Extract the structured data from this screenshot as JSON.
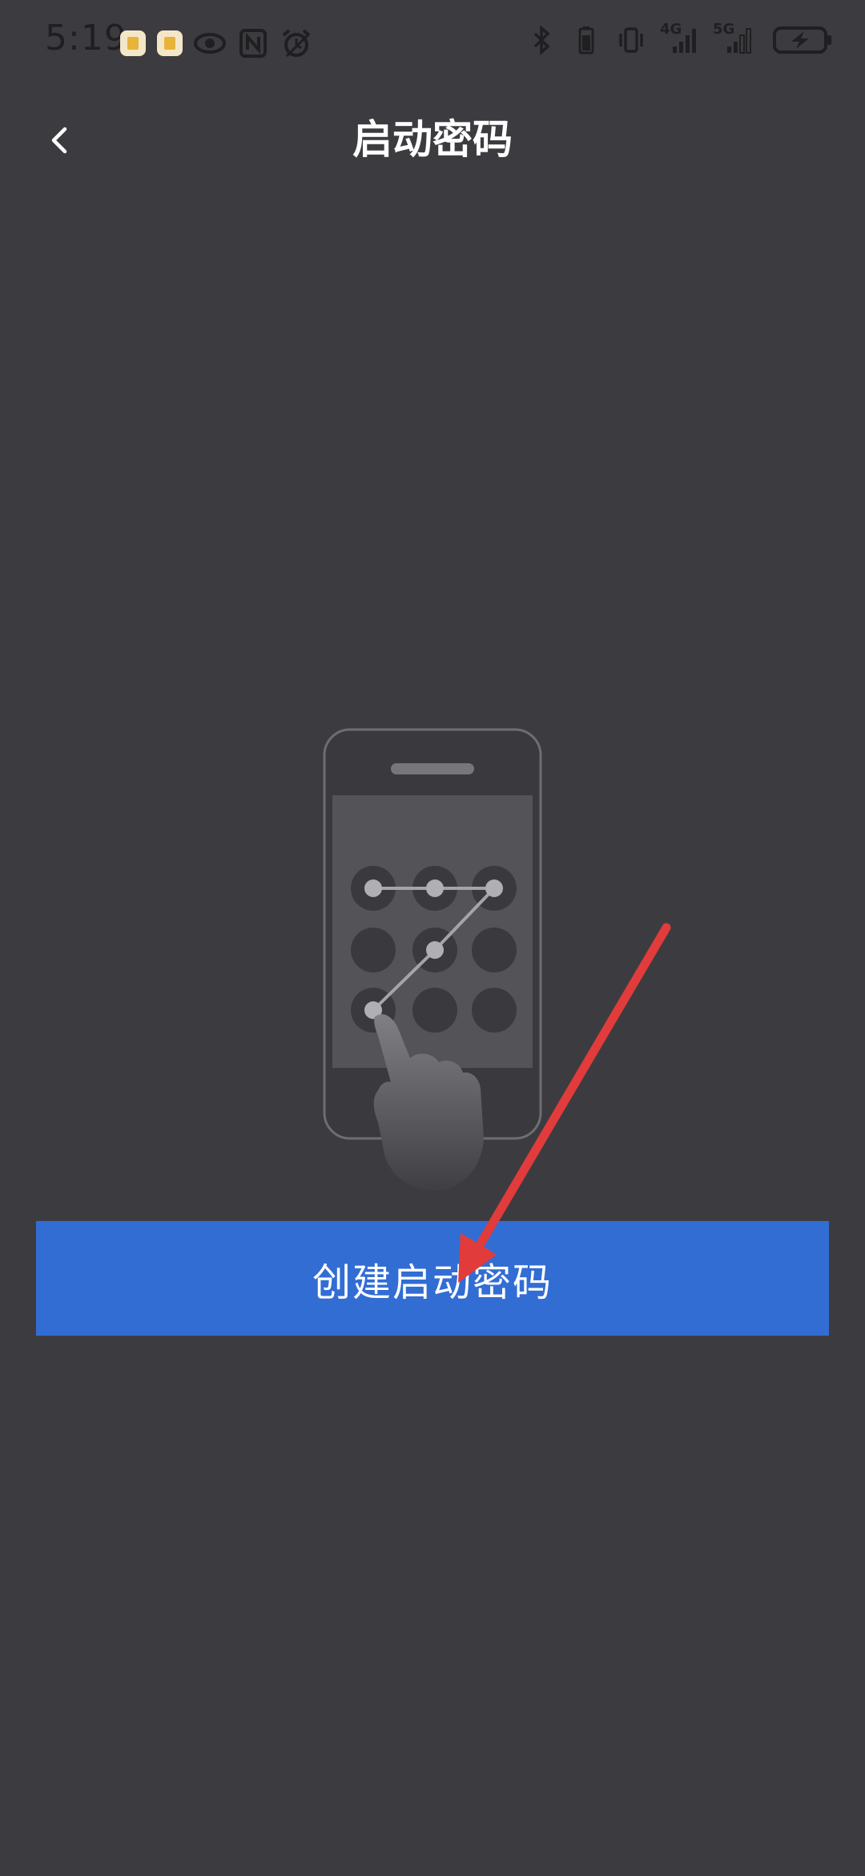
{
  "status_bar": {
    "time": "5:19",
    "net_4g": "4G",
    "net_5g": "5G",
    "left_icons": [
      "sim-icon",
      "sim-icon",
      "eye-icon",
      "nfc-icon",
      "alarm-icon"
    ],
    "right_icons": [
      "bluetooth-icon",
      "battery-small-icon",
      "vibrate-icon",
      "signal-4g-icon",
      "signal-5g-icon",
      "battery-charging-icon"
    ]
  },
  "header": {
    "title": "启动密码",
    "back_icon": "chevron-left-icon"
  },
  "illustration": {
    "description_icon": "pattern-lock-phone-icon"
  },
  "actions": {
    "create_label": "创建启动密码"
  },
  "colors": {
    "background": "#3c3c40",
    "primary_button": "#326dd4",
    "annotation_arrow": "#e23b3b"
  }
}
